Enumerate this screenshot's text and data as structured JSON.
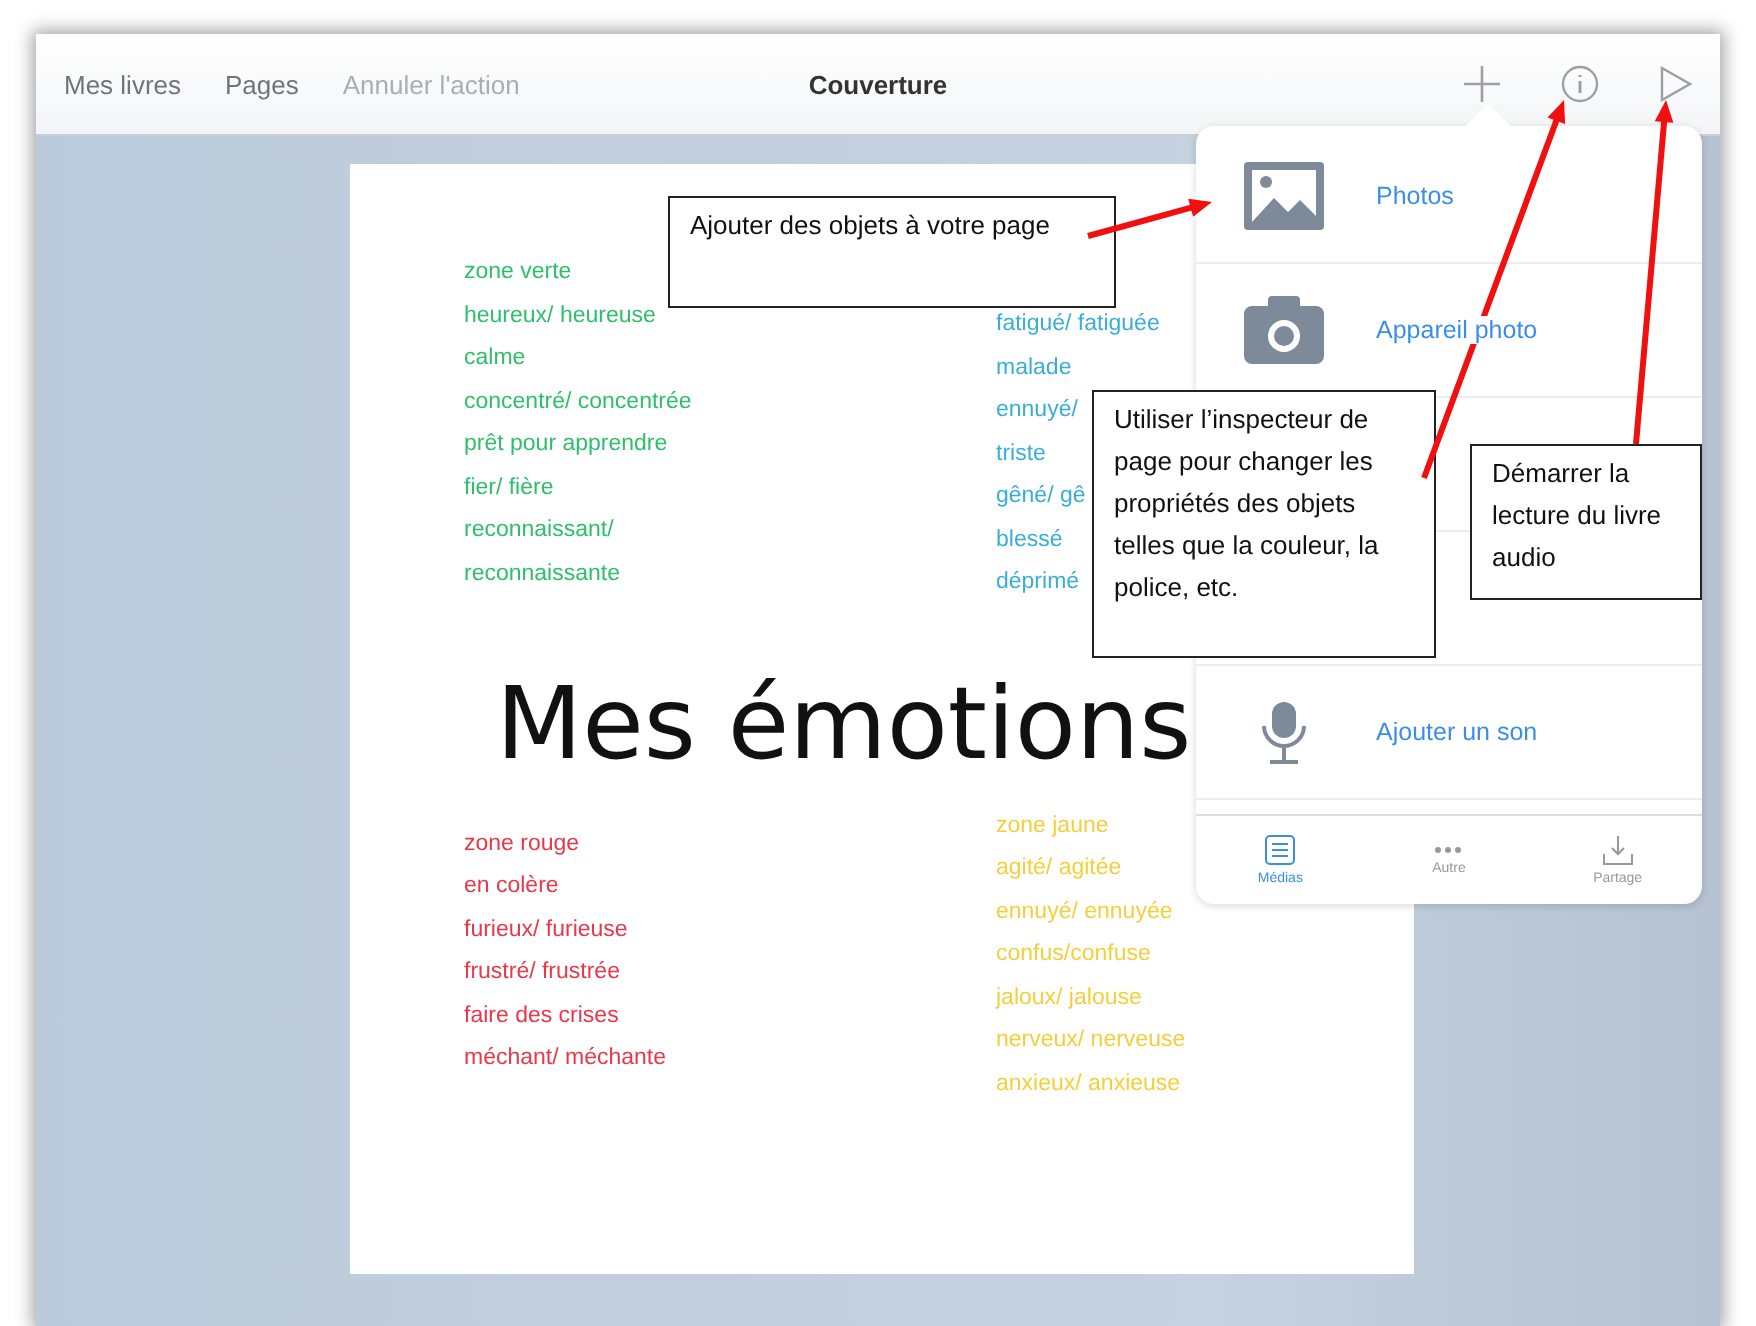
{
  "toolbar": {
    "left": [
      {
        "label": "Mes livres",
        "disabled": false
      },
      {
        "label": "Pages",
        "disabled": false
      },
      {
        "label": "Annuler l'action",
        "disabled": true
      }
    ],
    "title": "Couverture"
  },
  "page": {
    "title": "Mes émotions",
    "lists": [
      {
        "color": "#2fbf6a",
        "items": [
          "zone verte",
          "heureux/ heureuse",
          "calme",
          "concentré/ concentrée",
          "prêt pour apprendre",
          "fier/ fière",
          "reconnaissant/",
          "reconnaissante"
        ]
      },
      {
        "color": "#3aaed8",
        "items": [
          "fatigué/ fatiguée",
          "malade",
          "ennuyé/",
          "triste",
          "gêné/ gê",
          "blessé",
          "déprimé"
        ]
      },
      {
        "color": "#e8384a",
        "items": [
          "zone rouge",
          "en colère",
          "furieux/ furieuse",
          "frustré/ frustrée",
          "faire des crises",
          "méchant/ méchante"
        ]
      },
      {
        "color": "#f5cf3a",
        "items": [
          "zone jaune",
          "agité/ agitée",
          "ennuyé/ ennuyée",
          "confus/confuse",
          "jaloux/ jalouse",
          "nerveux/ nerveuse",
          "anxieux/ anxieuse"
        ]
      }
    ]
  },
  "popover": {
    "rows": [
      {
        "kind": "photo",
        "label": "Photos"
      },
      {
        "kind": "camera",
        "label": "Appareil photo"
      },
      {
        "kind": "covered"
      },
      {
        "kind": "covered"
      },
      {
        "kind": "mic",
        "label": "Ajouter un son"
      }
    ],
    "tabs": [
      {
        "kind": "list",
        "label": "Médias",
        "selected": true
      },
      {
        "kind": "dots",
        "label": "Autre",
        "selected": false
      },
      {
        "kind": "share",
        "label": "Partage",
        "selected": false
      }
    ]
  },
  "callouts": [
    "Ajouter des objets à votre page",
    "Utiliser l’inspecteur de page pour changer les propriétés des objets telles que la couleur, la police, etc.",
    "Démarrer la lecture du livre audio"
  ]
}
